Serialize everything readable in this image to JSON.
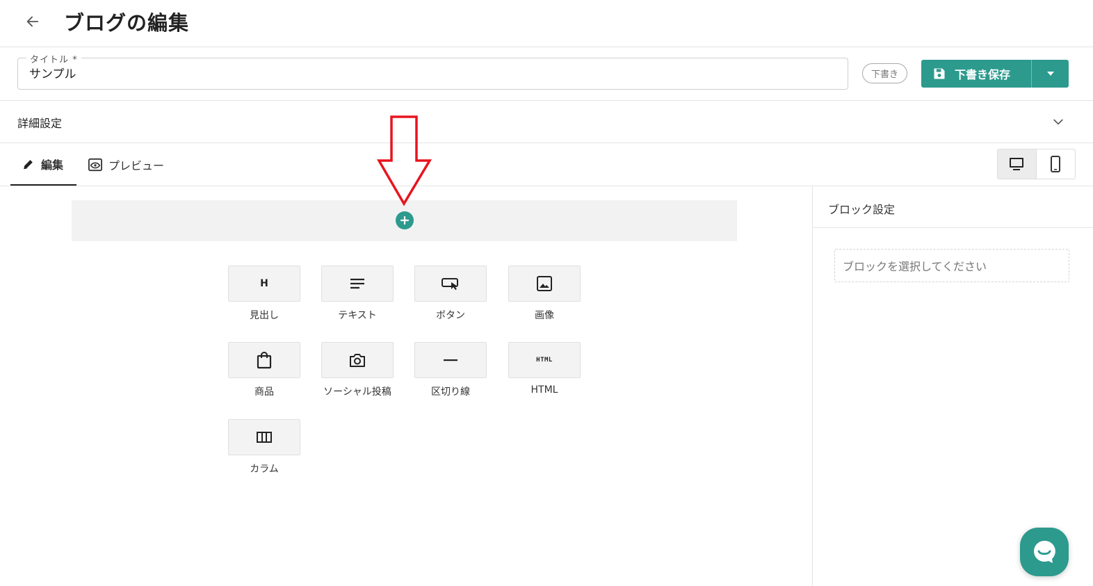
{
  "header": {
    "title": "ブログの編集"
  },
  "title_field": {
    "label": "タイトル *",
    "value": "サンプル"
  },
  "status_badge": "下書き",
  "save_button": {
    "label": "下書き保存"
  },
  "detail_settings": {
    "label": "詳細設定"
  },
  "tabs": [
    {
      "label": "編集",
      "active": true
    },
    {
      "label": "プレビュー",
      "active": false
    }
  ],
  "device_toggle": {
    "options": [
      "desktop-icon",
      "mobile-icon"
    ],
    "selected": "desktop"
  },
  "blocks": [
    {
      "label": "見出し",
      "icon": "heading-icon"
    },
    {
      "label": "テキスト",
      "icon": "text-lines-icon"
    },
    {
      "label": "ボタン",
      "icon": "button-click-icon"
    },
    {
      "label": "画像",
      "icon": "image-icon"
    },
    {
      "label": "商品",
      "icon": "shopping-bag-icon"
    },
    {
      "label": "ソーシャル投稿",
      "icon": "camera-icon"
    },
    {
      "label": "区切り線",
      "icon": "divider-icon"
    },
    {
      "label": "HTML",
      "icon": "html-icon"
    },
    {
      "label": "カラム",
      "icon": "columns-icon"
    }
  ],
  "block_icon_text": {
    "heading": "H",
    "html": "HTML"
  },
  "side_panel": {
    "title": "ブロック設定",
    "empty_message": "ブロックを選択してください"
  },
  "colors": {
    "accent": "#2d9a8e",
    "annotation_arrow": "#e8141e"
  }
}
